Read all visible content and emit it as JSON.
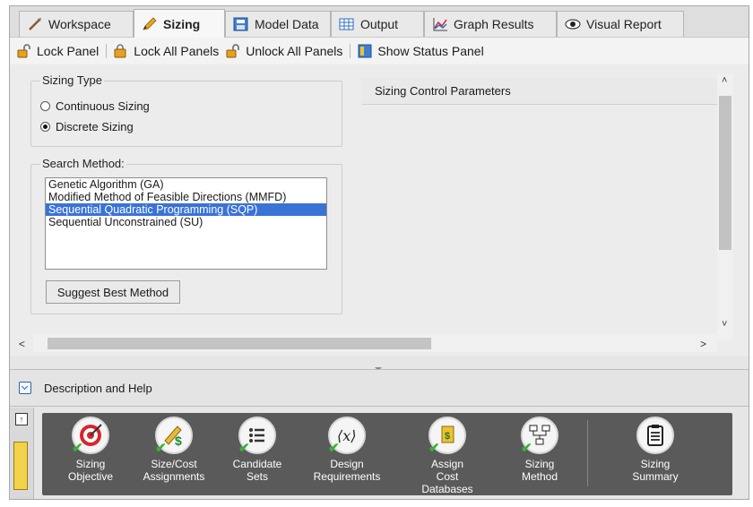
{
  "tabs": [
    {
      "label": "Workspace",
      "icon": "workspace-icon"
    },
    {
      "label": "Sizing",
      "icon": "pencil-icon",
      "active": true
    },
    {
      "label": "Model Data",
      "icon": "model-data-icon"
    },
    {
      "label": "Output",
      "icon": "output-table-icon"
    },
    {
      "label": "Graph Results",
      "icon": "graph-icon"
    },
    {
      "label": "Visual Report",
      "icon": "eye-icon"
    }
  ],
  "toolbar": {
    "lock_panel": "Lock Panel",
    "lock_all": "Lock All Panels",
    "unlock_all": "Unlock All Panels",
    "show_status": "Show Status Panel"
  },
  "sizing_type": {
    "title": "Sizing Type",
    "options": [
      "Continuous Sizing",
      "Discrete Sizing"
    ],
    "selected": "Discrete Sizing"
  },
  "search_method": {
    "title": "Search Method:",
    "items": [
      "Genetic Algorithm (GA)",
      "Modified Method of Feasible Directions (MMFD)",
      "Sequential Quadratic Programming (SQP)",
      "Sequential Unconstrained (SU)"
    ],
    "selected": "Sequential Quadratic Programming (SQP)",
    "suggest_button": "Suggest Best Method"
  },
  "params_header": "Sizing Control Parameters",
  "description_label": "Description and Help",
  "dock_tools": [
    {
      "line1": "Sizing",
      "line2": "Objective",
      "icon": "target-icon",
      "done": true
    },
    {
      "line1": "Size/Cost",
      "line2": "Assignments",
      "icon": "ruler-dollar-icon",
      "done": true
    },
    {
      "line1": "Candidate",
      "line2": "Sets",
      "icon": "list-icon",
      "done": true
    },
    {
      "line1": "Design",
      "line2": "Requirements",
      "icon": "variable-x-icon",
      "done": true
    },
    {
      "line1": "Assign",
      "line2": "Cost Databases",
      "icon": "cost-database-icon",
      "done": true
    },
    {
      "line1": "Sizing",
      "line2": "Method",
      "icon": "flowchart-icon",
      "done": true
    },
    {
      "line1": "Sizing",
      "line2": "Summary",
      "icon": "clipboard-icon",
      "done": false
    }
  ],
  "colors": {
    "selection": "#3a73d6",
    "dock": "#5a5a5a",
    "check": "#36b336"
  }
}
